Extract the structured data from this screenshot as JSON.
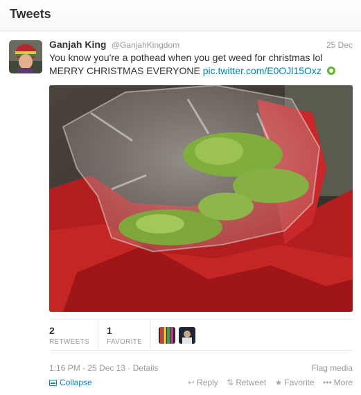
{
  "header": {
    "title": "Tweets"
  },
  "tweet": {
    "fullname": "Ganjah King",
    "username": "@GanjahKingdom",
    "date": "25 Dec",
    "text_line1": "You know you're a pothead when you get weed for christmas lol",
    "text_line2": "MERRY CHRISTMAS EVERYONE",
    "link": "pic.twitter.com/E0OJl15Oxz",
    "stats": {
      "retweets_count": "2",
      "retweets_label": "RETWEETS",
      "favorites_count": "1",
      "favorites_label": "FAVORITE"
    },
    "timestamp": "1:16 PM - 25 Dec 13",
    "details_label": "Details",
    "flag_label": "Flag media",
    "collapse_label": "Collapse",
    "actions": {
      "reply": "Reply",
      "retweet": "Retweet",
      "favorite": "Favorite",
      "more": "More"
    }
  },
  "icons": {
    "reply": "reply-icon",
    "retweet": "retweet-icon",
    "favorite": "star-icon",
    "more": "more-icon",
    "collapse": "collapse-icon",
    "media": "media-icon"
  },
  "colors": {
    "link": "#0084b4",
    "muted": "#999999",
    "text": "#333333",
    "media_badge": "#5db533"
  }
}
